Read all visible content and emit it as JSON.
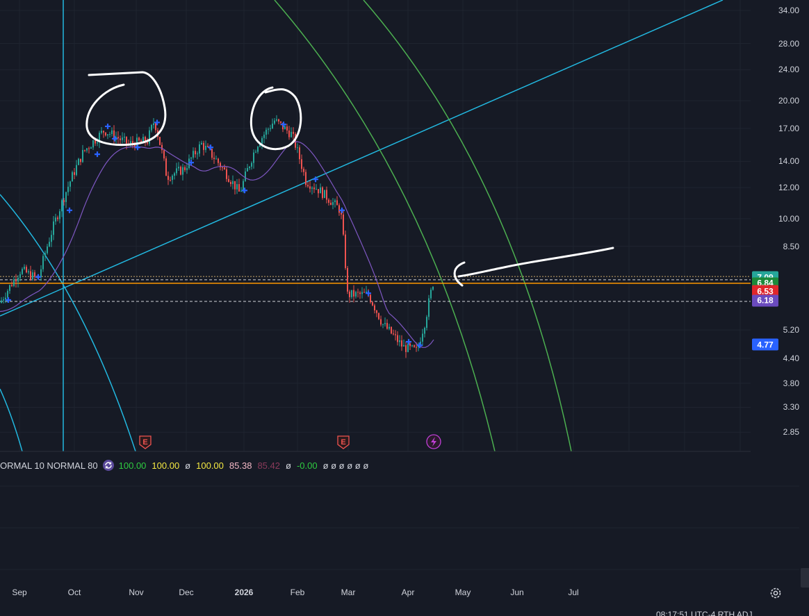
{
  "price_axis": {
    "ticks": [
      "34.00",
      "28.00",
      "24.00",
      "20.00",
      "17.00",
      "14.00",
      "12.00",
      "10.00",
      "8.50",
      "5.20",
      "4.40",
      "3.80",
      "3.30",
      "2.85"
    ]
  },
  "time_axis": {
    "labels": [
      "Sep",
      "Oct",
      "Nov",
      "Dec",
      "2026",
      "Feb",
      "Mar",
      "Apr",
      "May",
      "Jun",
      "Jul"
    ]
  },
  "price_badges": [
    {
      "value": "7.09",
      "color": "#26a69a"
    },
    {
      "value": "6.84",
      "color": "#1b8a3a"
    },
    {
      "value": "6.53",
      "color": "#e0262b"
    },
    {
      "value": "6.18",
      "color": "#6b4bbf"
    },
    {
      "value": "4.77",
      "color": "#2962ff"
    }
  ],
  "indicator_legend": {
    "name": "ORMAL 10 NORMAL 80",
    "values": [
      {
        "text": "100.00",
        "color": "#2ecc40"
      },
      {
        "text": "100.00",
        "color": "#f5e942"
      },
      {
        "text": "ø",
        "color": "#d1d4dc"
      },
      {
        "text": "100.00",
        "color": "#f5e942"
      },
      {
        "text": "85.38",
        "color": "#f2b8c6"
      },
      {
        "text": "85.42",
        "color": "#8a3a5a"
      },
      {
        "text": "ø",
        "color": "#d1d4dc"
      },
      {
        "text": "-0.00",
        "color": "#2ecc40"
      },
      {
        "text": "ø ø ø ø ø ø",
        "color": "#d1d4dc"
      }
    ]
  },
  "event_markers": [
    {
      "label": "E",
      "type": "earnings"
    },
    {
      "label": "E",
      "type": "earnings"
    },
    {
      "label": "lightning-icon",
      "type": "dividend"
    }
  ],
  "status_bar": {
    "text": "08:17:51 UTC-4   RTH   ADJ"
  },
  "colors": {
    "background": "#161a25",
    "up": "#26a69a",
    "down": "#ef5350",
    "moving_average": "#7e57c2",
    "gann_fan": "#22b8e0",
    "green_arcs": "#4caf50",
    "horizontal_orange": "#ff9800"
  }
}
